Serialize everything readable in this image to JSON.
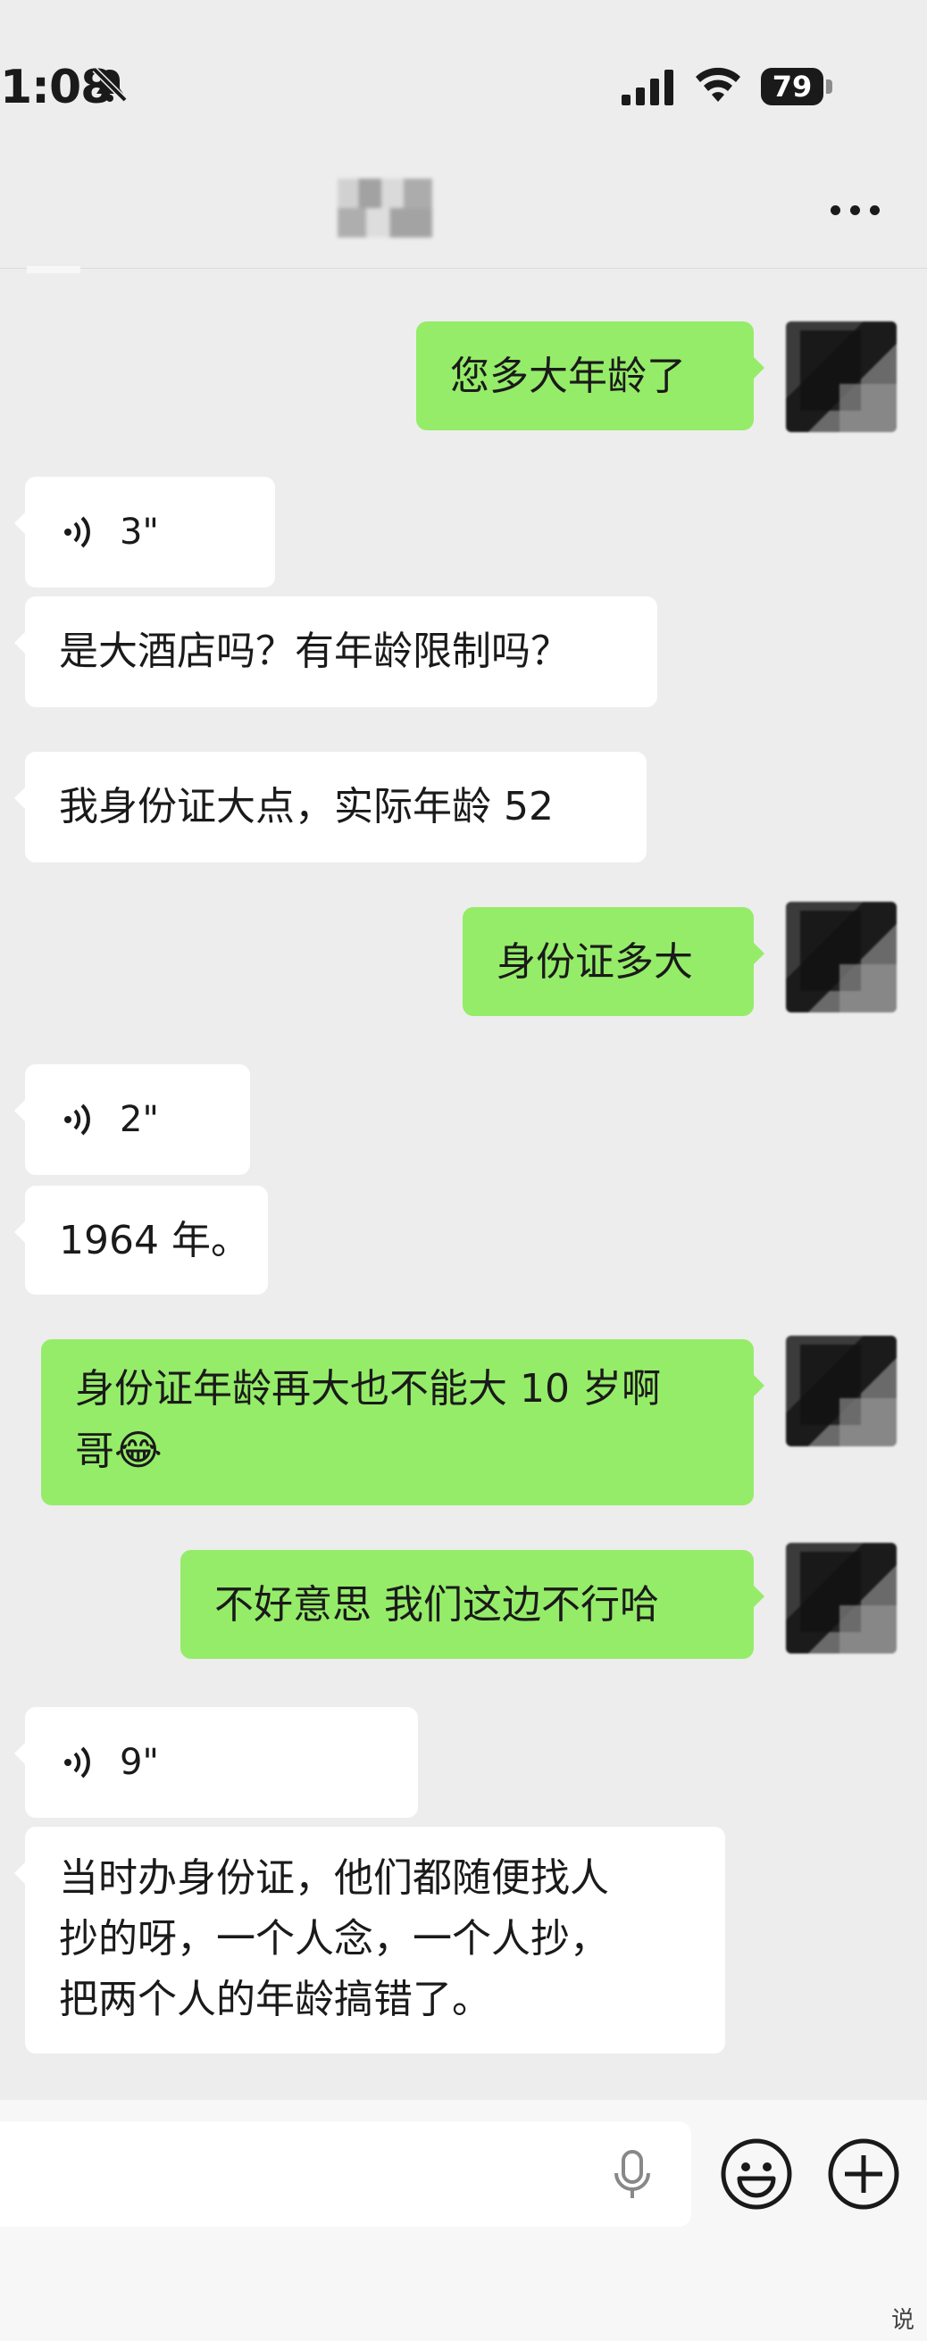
{
  "status_bar": {
    "time": "1:08",
    "battery": "79"
  },
  "header": {
    "more_icon": "more-dots-icon"
  },
  "messages": [
    {
      "side": "out",
      "type": "text",
      "text": "您多大年龄了"
    },
    {
      "side": "in",
      "type": "voice",
      "duration": "3\""
    },
    {
      "side": "in",
      "type": "text",
      "text": "是大酒店吗？有年龄限制吗？"
    },
    {
      "side": "in",
      "type": "text",
      "text": "我身份证大点，实际年龄 52"
    },
    {
      "side": "out",
      "type": "text",
      "text": "身份证多大"
    },
    {
      "side": "in",
      "type": "voice",
      "duration": "2\""
    },
    {
      "side": "in",
      "type": "text",
      "text": "1964 年。"
    },
    {
      "side": "out",
      "type": "text",
      "line1": "身份证年龄再大也不能大 10 岁啊",
      "line2": "哥",
      "emoji": "😂"
    },
    {
      "side": "out",
      "type": "text",
      "text": "不好意思 我们这边不行哈"
    },
    {
      "side": "in",
      "type": "voice",
      "duration": "9\""
    },
    {
      "side": "in",
      "type": "text",
      "line1": "当时办身份证，他们都随便找人",
      "line2": "抄的呀，一个人念，一个人抄，",
      "line3": "把两个人的年龄搞错了。"
    }
  ],
  "input_bar": {
    "mic_icon": "microphone-icon",
    "emoji_icon": "emoji-icon",
    "plus_icon": "plus-icon"
  },
  "corner_mark": "说"
}
